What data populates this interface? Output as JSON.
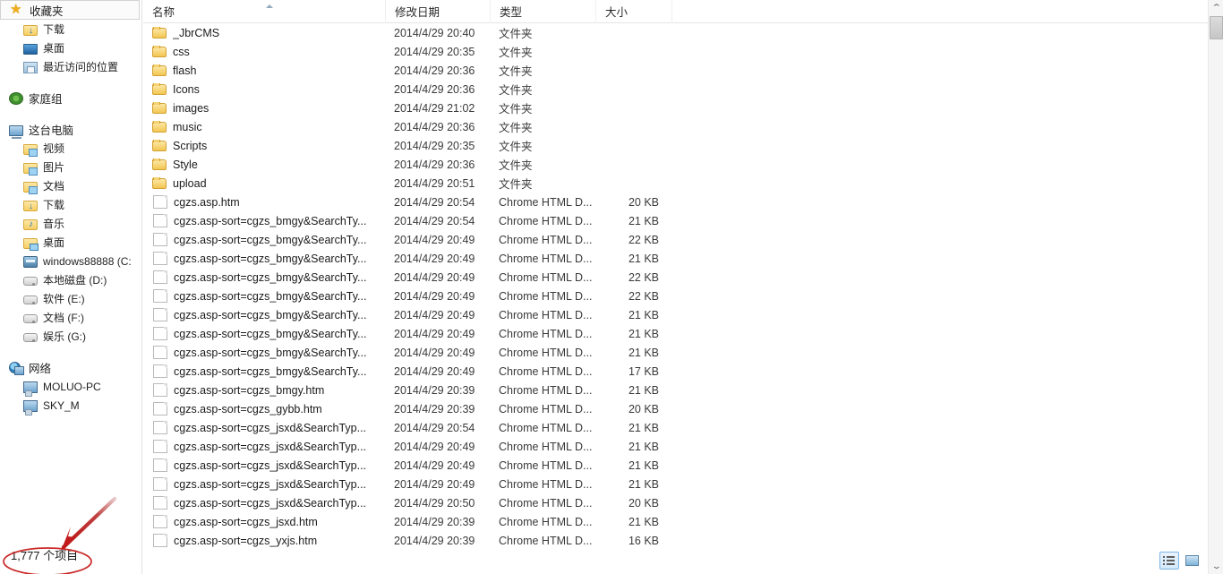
{
  "sidebar": {
    "groups": [
      {
        "header": {
          "label": "收藏夹",
          "icon": "star-icon",
          "focused": true
        },
        "items": [
          {
            "label": "下载",
            "icon": "folder-download-icon"
          },
          {
            "label": "桌面",
            "icon": "desktop-icon"
          },
          {
            "label": "最近访问的位置",
            "icon": "recent-places-icon"
          }
        ]
      },
      {
        "header": {
          "label": "家庭组",
          "icon": "homegroup-icon",
          "focused": false
        },
        "items": []
      },
      {
        "header": {
          "label": "这台电脑",
          "icon": "computer-icon",
          "focused": false
        },
        "items": [
          {
            "label": "视频",
            "icon": "folder-video-icon"
          },
          {
            "label": "图片",
            "icon": "folder-pictures-icon"
          },
          {
            "label": "文档",
            "icon": "folder-documents-icon"
          },
          {
            "label": "下载",
            "icon": "folder-download-icon"
          },
          {
            "label": "音乐",
            "icon": "folder-music-icon"
          },
          {
            "label": "桌面",
            "icon": "folder-desktop-icon"
          },
          {
            "label": "windows88888 (C:",
            "icon": "hdd-system-icon"
          },
          {
            "label": "本地磁盘 (D:)",
            "icon": "drive-icon"
          },
          {
            "label": "软件 (E:)",
            "icon": "drive-icon"
          },
          {
            "label": "文档 (F:)",
            "icon": "drive-icon"
          },
          {
            "label": "娱乐 (G:)",
            "icon": "drive-icon"
          }
        ]
      },
      {
        "header": {
          "label": "网络",
          "icon": "network-icon",
          "focused": false
        },
        "items": [
          {
            "label": "MOLUO-PC",
            "icon": "network-computer-icon"
          },
          {
            "label": "SKY_M",
            "icon": "network-computer-icon"
          }
        ]
      }
    ]
  },
  "columns": {
    "name": "名称",
    "date": "修改日期",
    "type": "类型",
    "size": "大小",
    "sort_column": "名称",
    "sort_direction": "ascending"
  },
  "files": [
    {
      "name": "_JbrCMS",
      "date": "2014/4/29 20:40",
      "type": "文件夹",
      "size": "",
      "kind": "folder"
    },
    {
      "name": "css",
      "date": "2014/4/29 20:35",
      "type": "文件夹",
      "size": "",
      "kind": "folder"
    },
    {
      "name": "flash",
      "date": "2014/4/29 20:36",
      "type": "文件夹",
      "size": "",
      "kind": "folder"
    },
    {
      "name": "Icons",
      "date": "2014/4/29 20:36",
      "type": "文件夹",
      "size": "",
      "kind": "folder"
    },
    {
      "name": "images",
      "date": "2014/4/29 21:02",
      "type": "文件夹",
      "size": "",
      "kind": "folder"
    },
    {
      "name": "music",
      "date": "2014/4/29 20:36",
      "type": "文件夹",
      "size": "",
      "kind": "folder"
    },
    {
      "name": "Scripts",
      "date": "2014/4/29 20:35",
      "type": "文件夹",
      "size": "",
      "kind": "folder"
    },
    {
      "name": "Style",
      "date": "2014/4/29 20:36",
      "type": "文件夹",
      "size": "",
      "kind": "folder"
    },
    {
      "name": "upload",
      "date": "2014/4/29 20:51",
      "type": "文件夹",
      "size": "",
      "kind": "folder"
    },
    {
      "name": "cgzs.asp.htm",
      "date": "2014/4/29 20:54",
      "type": "Chrome HTML D...",
      "size": "20 KB",
      "kind": "doc"
    },
    {
      "name": "cgzs.asp-sort=cgzs_bmgy&SearchTy...",
      "date": "2014/4/29 20:54",
      "type": "Chrome HTML D...",
      "size": "21 KB",
      "kind": "doc"
    },
    {
      "name": "cgzs.asp-sort=cgzs_bmgy&SearchTy...",
      "date": "2014/4/29 20:49",
      "type": "Chrome HTML D...",
      "size": "22 KB",
      "kind": "doc"
    },
    {
      "name": "cgzs.asp-sort=cgzs_bmgy&SearchTy...",
      "date": "2014/4/29 20:49",
      "type": "Chrome HTML D...",
      "size": "21 KB",
      "kind": "doc"
    },
    {
      "name": "cgzs.asp-sort=cgzs_bmgy&SearchTy...",
      "date": "2014/4/29 20:49",
      "type": "Chrome HTML D...",
      "size": "22 KB",
      "kind": "doc"
    },
    {
      "name": "cgzs.asp-sort=cgzs_bmgy&SearchTy...",
      "date": "2014/4/29 20:49",
      "type": "Chrome HTML D...",
      "size": "22 KB",
      "kind": "doc"
    },
    {
      "name": "cgzs.asp-sort=cgzs_bmgy&SearchTy...",
      "date": "2014/4/29 20:49",
      "type": "Chrome HTML D...",
      "size": "21 KB",
      "kind": "doc"
    },
    {
      "name": "cgzs.asp-sort=cgzs_bmgy&SearchTy...",
      "date": "2014/4/29 20:49",
      "type": "Chrome HTML D...",
      "size": "21 KB",
      "kind": "doc"
    },
    {
      "name": "cgzs.asp-sort=cgzs_bmgy&SearchTy...",
      "date": "2014/4/29 20:49",
      "type": "Chrome HTML D...",
      "size": "21 KB",
      "kind": "doc"
    },
    {
      "name": "cgzs.asp-sort=cgzs_bmgy&SearchTy...",
      "date": "2014/4/29 20:49",
      "type": "Chrome HTML D...",
      "size": "17 KB",
      "kind": "doc"
    },
    {
      "name": "cgzs.asp-sort=cgzs_bmgy.htm",
      "date": "2014/4/29 20:39",
      "type": "Chrome HTML D...",
      "size": "21 KB",
      "kind": "doc"
    },
    {
      "name": "cgzs.asp-sort=cgzs_gybb.htm",
      "date": "2014/4/29 20:39",
      "type": "Chrome HTML D...",
      "size": "20 KB",
      "kind": "doc"
    },
    {
      "name": "cgzs.asp-sort=cgzs_jsxd&SearchTyp...",
      "date": "2014/4/29 20:54",
      "type": "Chrome HTML D...",
      "size": "21 KB",
      "kind": "doc"
    },
    {
      "name": "cgzs.asp-sort=cgzs_jsxd&SearchTyp...",
      "date": "2014/4/29 20:49",
      "type": "Chrome HTML D...",
      "size": "21 KB",
      "kind": "doc"
    },
    {
      "name": "cgzs.asp-sort=cgzs_jsxd&SearchTyp...",
      "date": "2014/4/29 20:49",
      "type": "Chrome HTML D...",
      "size": "21 KB",
      "kind": "doc"
    },
    {
      "name": "cgzs.asp-sort=cgzs_jsxd&SearchTyp...",
      "date": "2014/4/29 20:49",
      "type": "Chrome HTML D...",
      "size": "21 KB",
      "kind": "doc"
    },
    {
      "name": "cgzs.asp-sort=cgzs_jsxd&SearchTyp...",
      "date": "2014/4/29 20:50",
      "type": "Chrome HTML D...",
      "size": "20 KB",
      "kind": "doc"
    },
    {
      "name": "cgzs.asp-sort=cgzs_jsxd.htm",
      "date": "2014/4/29 20:39",
      "type": "Chrome HTML D...",
      "size": "21 KB",
      "kind": "doc"
    },
    {
      "name": "cgzs.asp-sort=cgzs_yxjs.htm",
      "date": "2014/4/29 20:39",
      "type": "Chrome HTML D...",
      "size": "16 KB",
      "kind": "doc"
    }
  ],
  "status": {
    "item_count_label": "1,777 个项目"
  },
  "view_buttons": {
    "details_label": "详细信息",
    "icons_label": "大图标",
    "active": "details"
  },
  "scrollbar": {
    "up_arrow": "⌃",
    "down_arrow": "⌄"
  },
  "annotation": {
    "color": "#cc2222",
    "arrow_name": "red-arrow",
    "ellipse_name": "red-ellipse"
  }
}
